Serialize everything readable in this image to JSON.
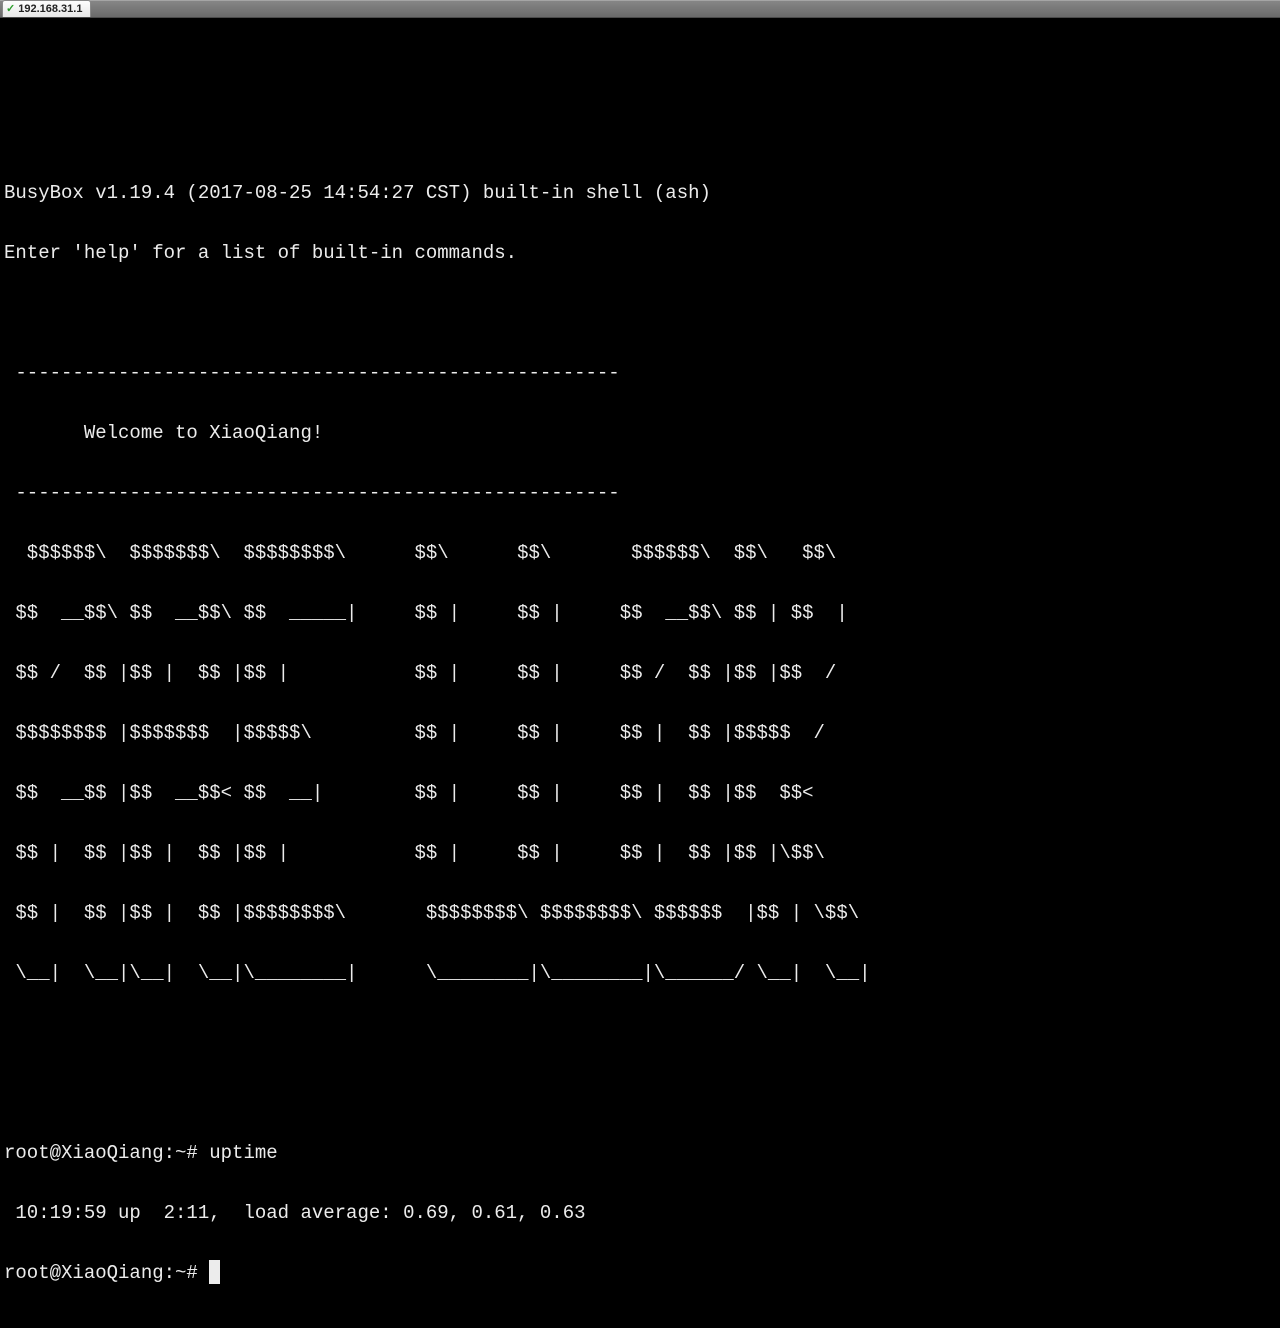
{
  "tab": {
    "host": "192.168.31.1"
  },
  "banner": {
    "line1": "BusyBox v1.19.4 (2017-08-25 14:54:27 CST) built-in shell (ash)",
    "line2": "Enter 'help' for a list of built-in commands."
  },
  "ascii": {
    "l01": " -----------------------------------------------------",
    "l02": "       Welcome to XiaoQiang!",
    "l03": " -----------------------------------------------------",
    "l04": "  $$$$$$\\  $$$$$$$\\  $$$$$$$$\\      $$\\      $$\\       $$$$$$\\  $$\\   $$\\",
    "l05": " $$  __$$\\ $$  __$$\\ $$  _____|     $$ |     $$ |     $$  __$$\\ $$ | $$  |",
    "l06": " $$ /  $$ |$$ |  $$ |$$ |           $$ |     $$ |     $$ /  $$ |$$ |$$  /",
    "l07": " $$$$$$$$ |$$$$$$$  |$$$$$\\         $$ |     $$ |     $$ |  $$ |$$$$$  /",
    "l08": " $$  __$$ |$$  __$$< $$  __|        $$ |     $$ |     $$ |  $$ |$$  $$<",
    "l09": " $$ |  $$ |$$ |  $$ |$$ |           $$ |     $$ |     $$ |  $$ |$$ |\\$$\\",
    "l10": " $$ |  $$ |$$ |  $$ |$$$$$$$$\\       $$$$$$$$\\ $$$$$$$$\\ $$$$$$  |$$ | \\$$\\",
    "l11": " \\__|  \\__|\\__|  \\__|\\________|      \\________|\\________|\\______/ \\__|  \\__|"
  },
  "session": {
    "prompt1": "root@XiaoQiang:~# ",
    "command1": "uptime",
    "output1": " 10:19:59 up  2:11,  load average: 0.69, 0.61, 0.63",
    "prompt2": "root@XiaoQiang:~# "
  }
}
